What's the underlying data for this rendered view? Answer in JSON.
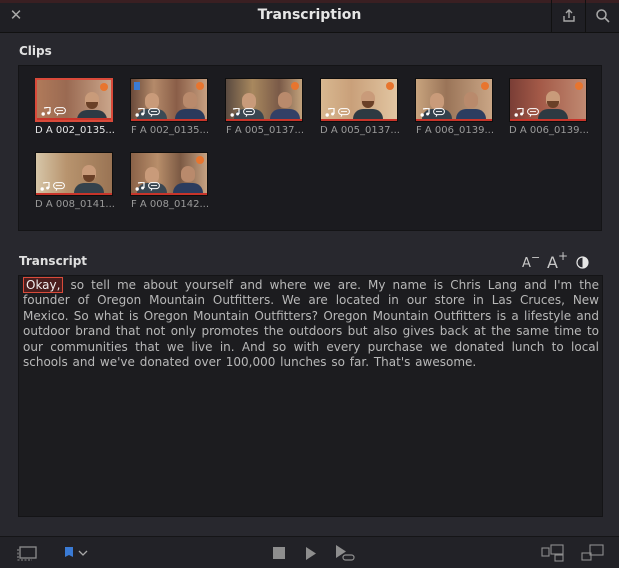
{
  "window": {
    "title": "Transcription"
  },
  "clips": {
    "heading": "Clips",
    "items": [
      {
        "name": "D A 002_0135...",
        "selected": true
      },
      {
        "name": "F A 002_0135...",
        "selected": false
      },
      {
        "name": "F A 005_0137...",
        "selected": false
      },
      {
        "name": "D A 005_0137...",
        "selected": false
      },
      {
        "name": "F A 006_0139...",
        "selected": false
      },
      {
        "name": "D A 006_0139...",
        "selected": false
      },
      {
        "name": "D A 008_0141...",
        "selected": false
      },
      {
        "name": "F A 008_0142...",
        "selected": false
      }
    ]
  },
  "transcript": {
    "heading": "Transcript",
    "decrease_font_label": "A",
    "decrease_font_sup": "−",
    "increase_font_label": "A",
    "increase_font_sup": "+",
    "highlighted_word": "Okay,",
    "text": " so tell me about yourself and where we are. My name is Chris Lang and I'm the founder of Oregon Mountain Outfitters. We are located in our store in Las Cruces, New Mexico. So what is Oregon Mountain Outfitters? Oregon Mountain Outfitters is a lifestyle and outdoor brand that not only promotes the outdoors but also gives back at the same time to our communities that we live in. And so with every purchase we donated lunch to local schools and we've donated over 100,000 lunches so far. That's awesome."
  },
  "colors": {
    "accent_red": "#d94a3a",
    "marker_orange": "#e8752e",
    "flag_blue": "#3a7bd5"
  }
}
